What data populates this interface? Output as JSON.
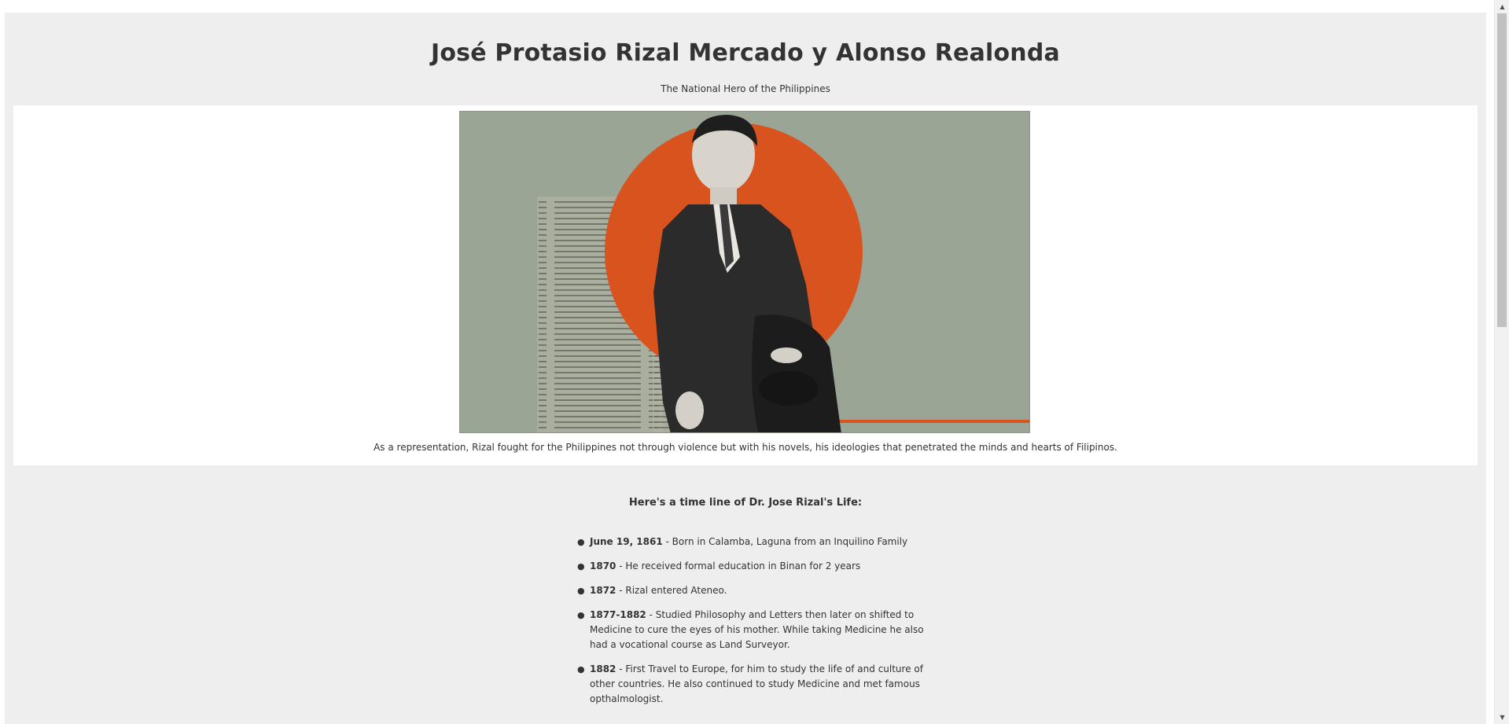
{
  "header": {
    "title": "José Protasio Rizal Mercado y Alonso Realonda",
    "subtitle": "The National Hero of the Philippines"
  },
  "image_section": {
    "caption": "As a representation, Rizal fought for the Philippines not through violence but with his novels, his ideologies that penetrated the minds and hearts of Filipinos."
  },
  "timeline": {
    "title": "Here's a time line of Dr. Jose Rizal's Life:",
    "items": [
      {
        "date": "June 19, 1861",
        "text": " - Born in Calamba, Laguna from an Inquilino Family"
      },
      {
        "date": "1870",
        "text": " - He received formal education in Binan for 2 years"
      },
      {
        "date": "1872",
        "text": " - Rizal entered Ateneo."
      },
      {
        "date": "1877-1882",
        "text": " - Studied Philosophy and Letters then later on shifted to Medicine to cure the eyes of his mother. While taking Medicine he also had a vocational course as Land Surveyor."
      },
      {
        "date": "1882",
        "text": " - First Travel to Europe, for him to study the life of and culture of other countries. He also continued to study Medicine and met famous opthalmologist."
      }
    ]
  },
  "colors": {
    "page_background": "#eeeeee",
    "image_background": "#ffffff",
    "photo_background": "#9ba595",
    "sun_orange": "#d9531e",
    "text": "#333333"
  }
}
